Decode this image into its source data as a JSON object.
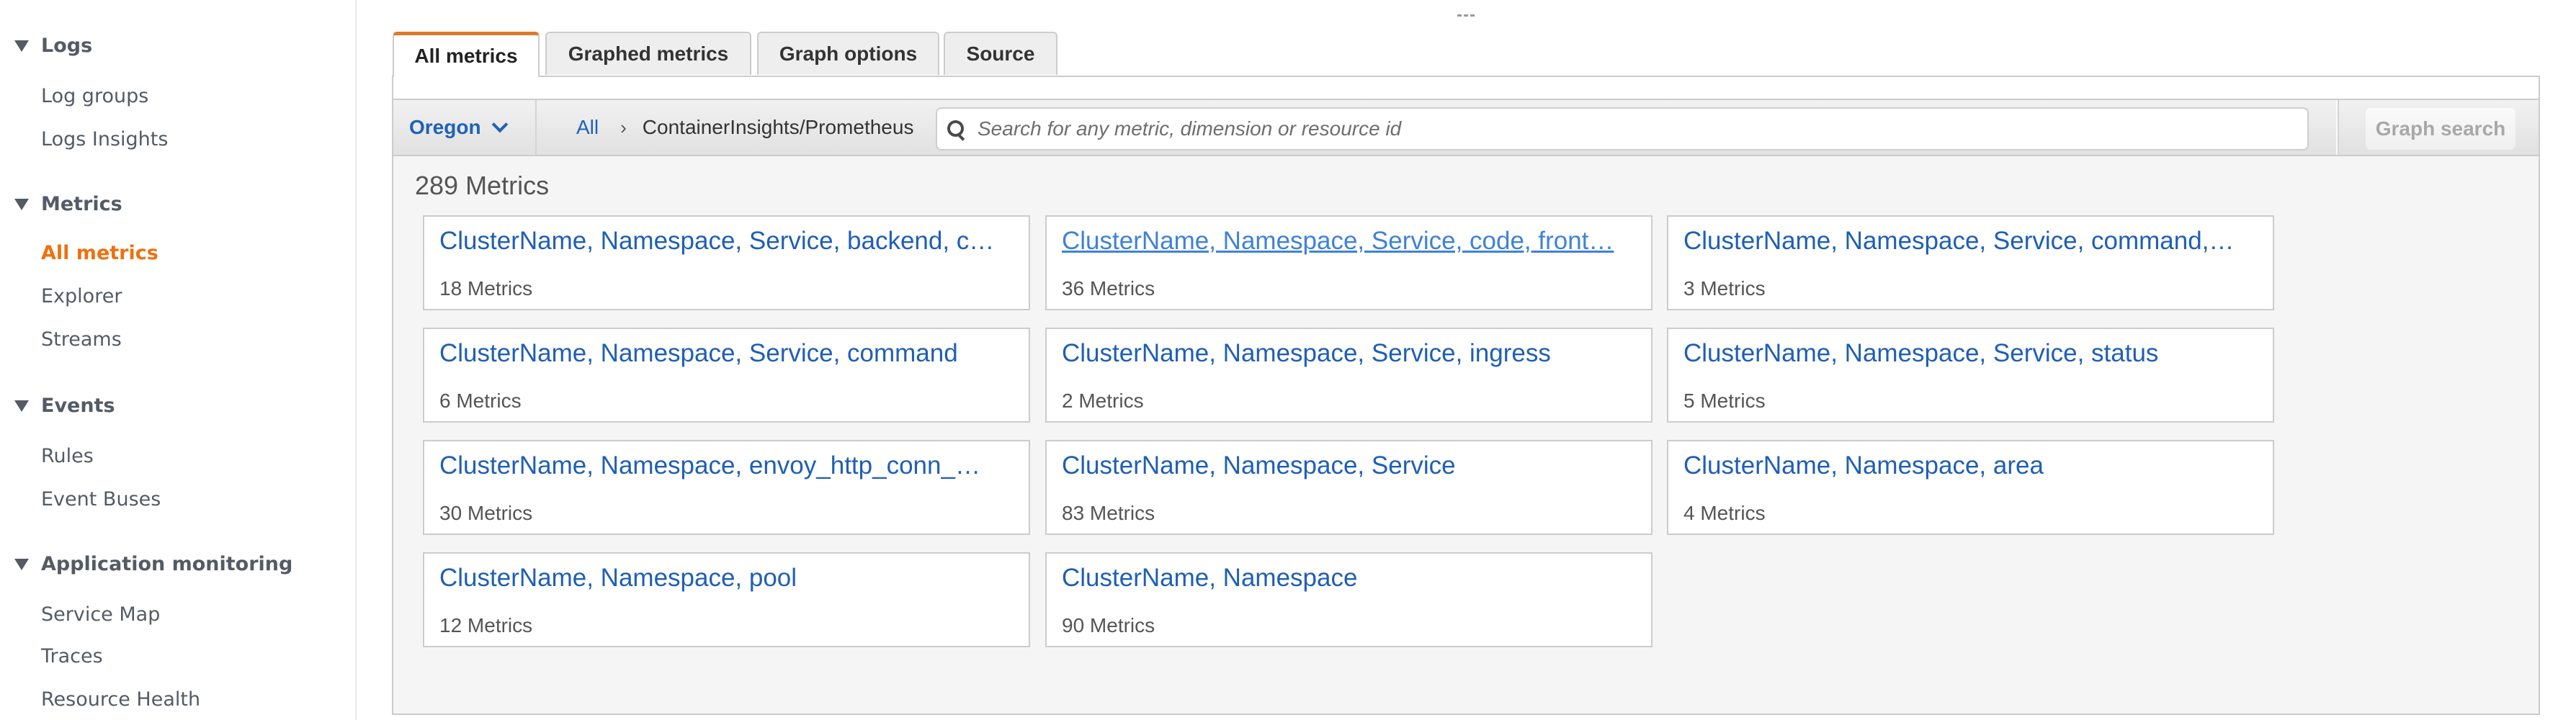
{
  "sidebar": {
    "sections": [
      {
        "heading": "Logs",
        "items": [
          {
            "label": "Log groups"
          },
          {
            "label": "Logs Insights"
          }
        ]
      },
      {
        "heading": "Metrics",
        "items": [
          {
            "label": "All metrics",
            "active": true
          },
          {
            "label": "Explorer"
          },
          {
            "label": "Streams"
          }
        ]
      },
      {
        "heading": "Events",
        "items": [
          {
            "label": "Rules"
          },
          {
            "label": "Event Buses"
          }
        ]
      },
      {
        "heading": "Application monitoring",
        "items": [
          {
            "label": "Service Map"
          },
          {
            "label": "Traces"
          },
          {
            "label": "Resource Health"
          }
        ]
      }
    ]
  },
  "tabs": [
    {
      "label": "All metrics",
      "active": true
    },
    {
      "label": "Graphed metrics"
    },
    {
      "label": "Graph options"
    },
    {
      "label": "Source"
    }
  ],
  "toolbar": {
    "region": "Oregon",
    "breadcrumb_root": "All",
    "breadcrumb_separator": "›",
    "breadcrumb_current": "ContainerInsights/Prometheus",
    "search_placeholder": "Search for any metric, dimension or resource id",
    "search_value": "",
    "graph_search_label": "Graph search"
  },
  "colors": {
    "accent_orange": "#ec7211",
    "tab_active_border": "#dd7a2c",
    "link_blue": "#1f5fb4",
    "link_hover_blue": "#3f82d6"
  },
  "metrics_total": "289 Metrics",
  "namespaces": [
    {
      "title": "ClusterName, Namespace, Service, backend, c…",
      "count": "18 Metrics"
    },
    {
      "title": "ClusterName, Namespace, Service, code, front…",
      "count": "36 Metrics",
      "hovered": true
    },
    {
      "title": "ClusterName, Namespace, Service, command,…",
      "count": "3 Metrics"
    },
    {
      "title": "ClusterName, Namespace, Service, command",
      "count": "6 Metrics"
    },
    {
      "title": "ClusterName, Namespace, Service, ingress",
      "count": "2 Metrics"
    },
    {
      "title": "ClusterName, Namespace, Service, status",
      "count": "5 Metrics"
    },
    {
      "title": "ClusterName, Namespace, envoy_http_conn_…",
      "count": "30 Metrics"
    },
    {
      "title": "ClusterName, Namespace, Service",
      "count": "83 Metrics"
    },
    {
      "title": "ClusterName, Namespace, area",
      "count": "4 Metrics"
    },
    {
      "title": "ClusterName, Namespace, pool",
      "count": "12 Metrics"
    },
    {
      "title": "ClusterName, Namespace",
      "count": "90 Metrics"
    }
  ]
}
